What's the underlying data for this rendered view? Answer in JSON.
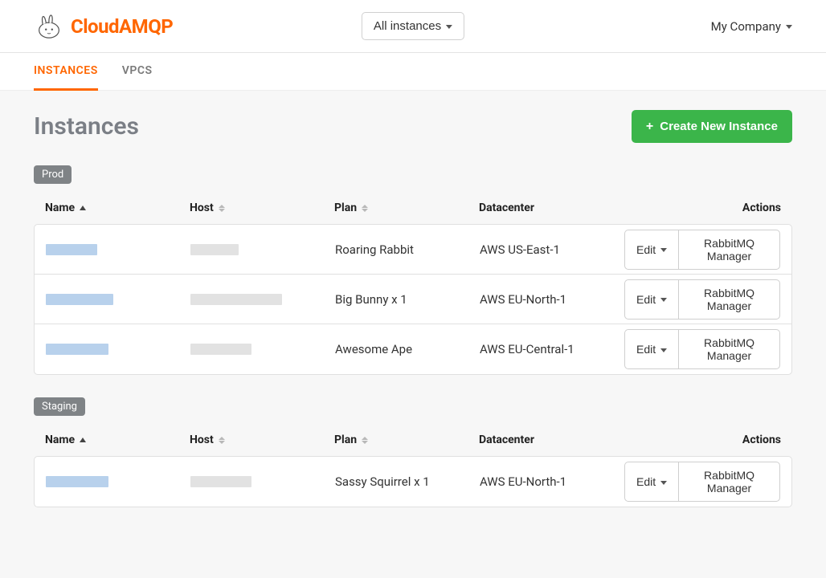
{
  "header": {
    "brand": "CloudAMQP",
    "instances_filter": "All instances",
    "company": "My Company"
  },
  "nav": {
    "instances": "INSTANCES",
    "vpcs": "VPCS"
  },
  "page": {
    "title": "Instances",
    "create_button": "Create New Instance"
  },
  "columns": {
    "name": "Name",
    "host": "Host",
    "plan": "Plan",
    "datacenter": "Datacenter",
    "actions": "Actions"
  },
  "actions": {
    "edit": "Edit",
    "manager": "RabbitMQ Manager"
  },
  "groups": [
    {
      "tag": "Prod",
      "rows": [
        {
          "plan": "Roaring Rabbit",
          "datacenter": "AWS US-East-1",
          "name_w": "",
          "host_w": ""
        },
        {
          "plan": "Big Bunny x 1",
          "datacenter": "AWS EU-North-1",
          "name_w": "w2",
          "host_w": "w2"
        },
        {
          "plan": "Awesome Ape",
          "datacenter": "AWS EU-Central-1",
          "name_w": "w3",
          "host_w": "w3"
        }
      ]
    },
    {
      "tag": "Staging",
      "rows": [
        {
          "plan": "Sassy Squirrel x 1",
          "datacenter": "AWS EU-North-1",
          "name_w": "w3",
          "host_w": "w3"
        }
      ]
    }
  ]
}
